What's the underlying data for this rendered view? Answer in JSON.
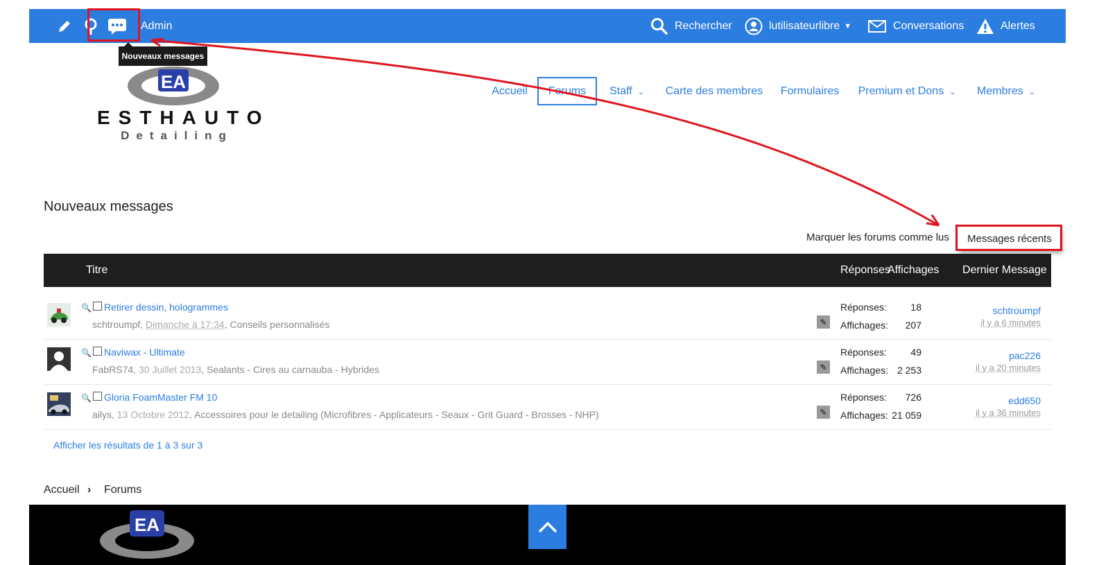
{
  "topbar": {
    "admin_label": "Admin",
    "search_label": "Rechercher",
    "user_label": "lutilisateurlibre",
    "conversations_label": "Conversations",
    "alerts_label": "Alertes",
    "tooltip": "Nouveaux messages"
  },
  "logo": {
    "name": "ESTHAUTO",
    "tagline": "Detailing"
  },
  "nav": [
    "Accueil",
    "Forums",
    "Staff",
    "Carte des membres",
    "Formulaires",
    "Premium et Dons",
    "Membres"
  ],
  "page": {
    "title": "Nouveaux messages",
    "mark_read": "Marquer les forums comme lus",
    "recent_messages": "Messages récents"
  },
  "table": {
    "headers": {
      "title": "Titre",
      "replies": "Réponses",
      "views": "Affichages",
      "last": "Dernier Message"
    },
    "replies_label": "Réponses:",
    "views_label": "Affichages:",
    "rows": [
      {
        "title": "Retirer dessin, hologrammes",
        "author": "schtroumpf",
        "date": "Dimanche à 17:34",
        "forum": "Conseils personnalisés",
        "replies": "18",
        "views": "207",
        "last_user": "schtroumpf",
        "last_time": "il y a 6 minutes"
      },
      {
        "title": "Naviwax - Ultimate",
        "author": "FabRS74",
        "date": "30 Juillet 2013",
        "forum": "Sealants - Cires au carnauba - Hybrides",
        "replies": "49",
        "views": "2 253",
        "last_user": "pac226",
        "last_time": "il y a 20 minutes"
      },
      {
        "title": "Gloria FoamMaster FM 10",
        "author": "ailys",
        "date": "13 Octobre 2012",
        "forum": "Accessoires pour le detailing (Microfibres - Applicateurs - Seaux - Grit Guard - Brosses - NHP)",
        "replies": "726",
        "views": "21 059",
        "last_user": "edd650",
        "last_time": "il y a 36 minutes"
      }
    ]
  },
  "results": "Afficher les résultats de 1 à 3 sur 3",
  "breadcrumb": {
    "home": "Accueil",
    "sep": "›",
    "forums": "Forums"
  },
  "colors": {
    "primary": "#2c7de0",
    "highlight": "#e0141e",
    "header_dark": "#1e1e1e"
  }
}
